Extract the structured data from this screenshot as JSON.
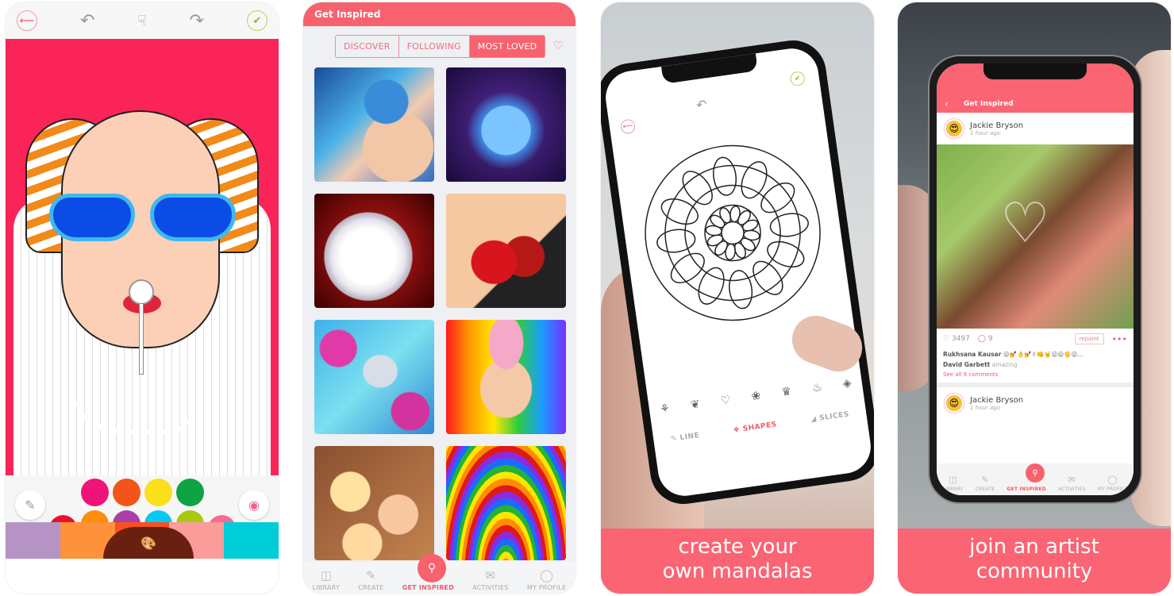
{
  "panel1": {
    "toolbar": {
      "back_icon": "back-arrow-icon",
      "undo_icon": "undo-arrow-icon",
      "gesture_icon": "hand-tap-icon",
      "redo_icon": "redo-arrow-icon",
      "done_icon": "checkmark-icon"
    },
    "canvas_bg": "#fa2458",
    "palette_top_row": [
      "#f0137a",
      "#f3541a",
      "#f9e01b",
      "#0ea444"
    ],
    "palette_bottom_row": [
      "#ea1030",
      "#fd8d0c",
      "#ac3fa7",
      "#06c9f3",
      "#a8c90e",
      "#f96990"
    ],
    "palette_tabs": [
      "#b594c5",
      "#fd923a",
      "#f8501f",
      "#fb9b9a",
      "#00cdd8"
    ],
    "left_tool_icon": "brush-cup-icon",
    "right_tool_icon": "recent-color-icon",
    "tab_icon": "palette-icon"
  },
  "panel2": {
    "header_title": "Get Inspired",
    "tabs": [
      {
        "label": "DISCOVER",
        "active": false
      },
      {
        "label": "FOLLOWING",
        "active": false
      },
      {
        "label": "MOST LOVED",
        "active": true
      }
    ],
    "heart_icon": "heart-outline-icon",
    "gallery": [
      "blue-lips-portrait",
      "blue-roses",
      "white-chrysanthemum",
      "strawberry-lips",
      "bird-on-blossoms",
      "girl-with-lollipop",
      "peach-flowers",
      "rainbow-swirl"
    ],
    "nav": [
      {
        "label": "LIBRARY",
        "icon": "book-icon",
        "active": false
      },
      {
        "label": "CREATE",
        "icon": "pencil-icon",
        "active": false
      },
      {
        "label": "GET INSPIRED",
        "icon": "magnifier-heart-icon",
        "active": true
      },
      {
        "label": "ACTIVITIES",
        "icon": "envelope-icon",
        "active": false
      },
      {
        "label": "MY PROFILE",
        "icon": "person-icon",
        "active": false
      }
    ],
    "accent": "#f8616e"
  },
  "panel3": {
    "shape_icons": [
      "lotus-icon",
      "leaf-icon",
      "heart-icon",
      "flower-icon",
      "crown-icon",
      "flame-icon",
      "layers-icon"
    ],
    "modes": [
      {
        "label": "LINE",
        "active": false
      },
      {
        "label": "SHAPES",
        "active": true
      },
      {
        "label": "SLICES",
        "active": false
      }
    ],
    "caption_line1": "create your",
    "caption_line2": "own mandalas"
  },
  "panel4": {
    "header_title": "Get Inspired",
    "post1": {
      "name": "Jackie Bryson",
      "time": "1 hour ago"
    },
    "likes": "3497",
    "comments_count": "9",
    "repaint_label": "repaint",
    "comments": [
      {
        "author": "Rukhsana Kausar",
        "text": "😛💅👌💅✌👊🤘😛😛🖐😛..."
      },
      {
        "author": "David Garbett",
        "text": "amazing"
      }
    ],
    "see_all": "See all 9 comments",
    "post2": {
      "name": "Jackie Bryson",
      "time": "1 hour ago"
    },
    "nav": [
      "LIBRARY",
      "CREATE",
      "GET INSPIRED",
      "ACTIVITIES",
      "MY PROFILE"
    ],
    "caption_line1": "join an artist",
    "caption_line2": "community"
  }
}
